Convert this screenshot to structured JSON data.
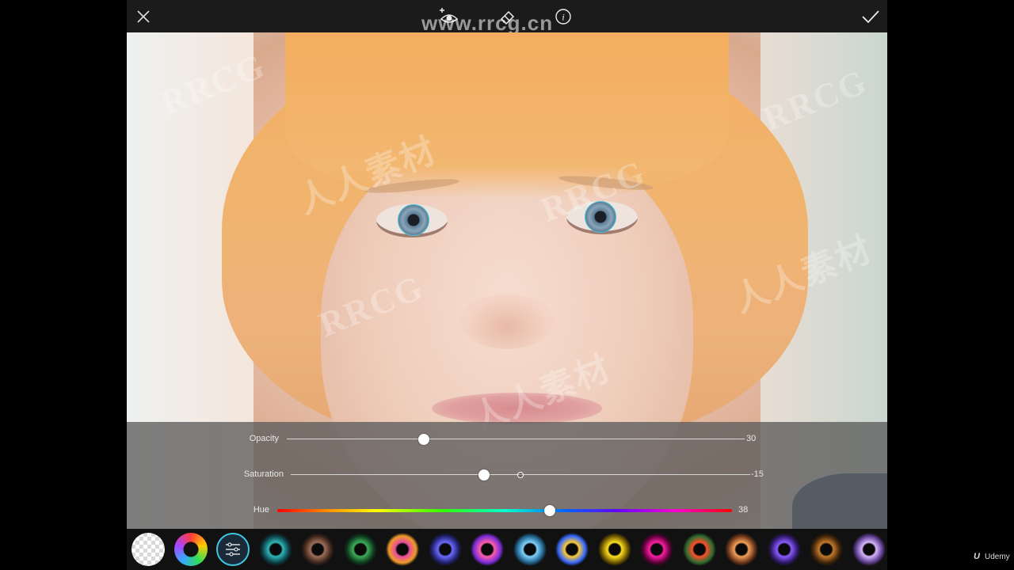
{
  "toolbar": {
    "close_icon": "close-icon",
    "add_eye_icon": "add-eye-icon",
    "eraser_icon": "eraser-icon",
    "info_icon": "info-icon",
    "apply_icon": "checkmark-icon"
  },
  "watermarks": {
    "url": "www.rrcg.cn",
    "latin": "RRCG",
    "cjk": "人人素材"
  },
  "adjustments": {
    "opacity": {
      "label": "Opacity",
      "value": "30",
      "fraction": 0.3
    },
    "saturation": {
      "label": "Saturation",
      "value": "-15",
      "fraction": 0.42,
      "default_fraction": 0.5
    },
    "hue": {
      "label": "Hue",
      "value": "38",
      "fraction": 0.6
    }
  },
  "iris_presets": [
    {
      "name": "none",
      "colors": [
        "#cccccc",
        "#999999"
      ],
      "selected": false
    },
    {
      "name": "rainbow",
      "colors": [
        "#ff3b3b",
        "#3bb0ff"
      ],
      "selected": false
    },
    {
      "name": "adjust",
      "colors": [
        "#1b2a38",
        "#1b2a38"
      ],
      "selected": true
    },
    {
      "name": "teal",
      "colors": [
        "#2fb9b8",
        "#0c3d45"
      ]
    },
    {
      "name": "brown",
      "colors": [
        "#a0705a",
        "#3c241a"
      ]
    },
    {
      "name": "green",
      "colors": [
        "#3fae5a",
        "#0d3a1d"
      ]
    },
    {
      "name": "magenta-orange",
      "colors": [
        "#e64a9c",
        "#f09a2a"
      ]
    },
    {
      "name": "purple-blue",
      "colors": [
        "#6b6bff",
        "#20206b"
      ]
    },
    {
      "name": "pink-purple",
      "colors": [
        "#ff5ea9",
        "#7a2bd6"
      ]
    },
    {
      "name": "ice-blue",
      "colors": [
        "#7fd3ff",
        "#1f5f88"
      ]
    },
    {
      "name": "multicolor",
      "colors": [
        "#ffcc33",
        "#3366ff"
      ]
    },
    {
      "name": "cat-yellow",
      "colors": [
        "#ffe21f",
        "#6b5200"
      ]
    },
    {
      "name": "magenta",
      "colors": [
        "#ff1fa6",
        "#5a0037"
      ]
    },
    {
      "name": "fire",
      "colors": [
        "#ff4f2a",
        "#2e6b30"
      ]
    },
    {
      "name": "amber",
      "colors": [
        "#f5a35a",
        "#6a3418"
      ]
    },
    {
      "name": "violet",
      "colors": [
        "#8a5cff",
        "#2d1766"
      ]
    },
    {
      "name": "copper",
      "colors": [
        "#c47a2c",
        "#3f2409"
      ]
    },
    {
      "name": "lavender",
      "colors": [
        "#d7b8ff",
        "#5a3a8a"
      ]
    }
  ],
  "branding": {
    "udemy": "Udemy",
    "udemy_mark": "U"
  }
}
